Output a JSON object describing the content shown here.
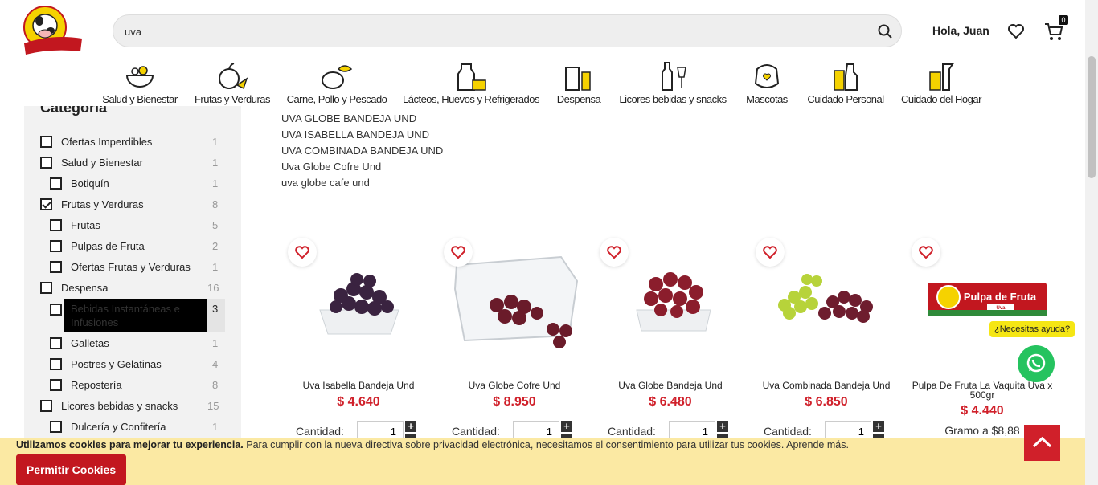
{
  "header": {
    "search_value": "uva",
    "search_icon": "search-icon",
    "greeting": "Hola, Juan",
    "cart_count": "0",
    "logo_alt": "La Vaquita"
  },
  "categories": [
    {
      "label": "Salud y Bienestar",
      "icon": "health-bowl-icon"
    },
    {
      "label": "Frutas y Verduras",
      "icon": "fruit-icon"
    },
    {
      "label": "Carne, Pollo y Pescado",
      "icon": "meat-icon"
    },
    {
      "label": "Lácteos, Huevos y Refrigerados",
      "icon": "dairy-icon"
    },
    {
      "label": "Despensa",
      "icon": "pantry-icon"
    },
    {
      "label": "Licores bebidas y snacks",
      "icon": "bottles-icon"
    },
    {
      "label": "Mascotas",
      "icon": "pet-icon"
    },
    {
      "label": "Cuidado Personal",
      "icon": "personal-care-icon"
    },
    {
      "label": "Cuidado del Hogar",
      "icon": "home-care-icon"
    }
  ],
  "sidebar": {
    "title": "Categoría",
    "facets": [
      {
        "label": "Ofertas Imperdibles",
        "count": "1",
        "checked": false
      },
      {
        "label": "Salud y Bienestar",
        "count": "1",
        "checked": false
      },
      {
        "label": "Botiquín",
        "count": "1",
        "checked": false
      },
      {
        "label": "Frutas y Verduras",
        "count": "8",
        "checked": true
      },
      {
        "label": "Frutas",
        "count": "5",
        "checked": false
      },
      {
        "label": "Pulpas de Fruta",
        "count": "2",
        "checked": false
      },
      {
        "label": "Ofertas Frutas y Verduras",
        "count": "1",
        "checked": false
      },
      {
        "label": "Despensa",
        "count": "16",
        "checked": false
      },
      {
        "label": "Bebidas Instantáneas e Infusiones",
        "count": "3",
        "checked": false
      },
      {
        "label": "Galletas",
        "count": "1",
        "checked": false
      },
      {
        "label": "Postres y Gelatinas",
        "count": "4",
        "checked": false
      },
      {
        "label": "Repostería",
        "count": "8",
        "checked": false
      },
      {
        "label": "Licores bebidas y snacks",
        "count": "15",
        "checked": false
      },
      {
        "label": "Dulcería y Confitería",
        "count": "1",
        "checked": false
      }
    ]
  },
  "suggestions": [
    "UVA GLOBE BANDEJA UND",
    "UVA ISABELLA BANDEJA UND",
    "UVA COMBINADA BANDEJA UND",
    "Uva Globe Cofre Und",
    "uva globe cafe und"
  ],
  "products": [
    {
      "name": "Uva Isabella Bandeja Und",
      "price": "$ 4.640",
      "qty_label": "Cantidad:",
      "qty": "1"
    },
    {
      "name": "Uva Globe Cofre Und",
      "price": "$ 8.950",
      "qty_label": "Cantidad:",
      "qty": "1"
    },
    {
      "name": "Uva Globe Bandeja Und",
      "price": "$ 6.480",
      "qty_label": "Cantidad:",
      "qty": "1"
    },
    {
      "name": "Uva Combinada Bandeja Und",
      "price": "$ 6.850",
      "qty_label": "Cantidad:",
      "qty": "1"
    },
    {
      "name": "Pulpa De Fruta La Vaquita Uva x 500gr",
      "price": "$ 4.440",
      "unit_price": "Gramo a $8,88",
      "pack_text": "Pulpa de Fruta",
      "pack_flavor": "Uva"
    }
  ],
  "whatsapp": {
    "help_text": "¿Necesitas ayuda?"
  },
  "cookie": {
    "bold": "Utilizamos cookies para mejorar tu experiencia.",
    "text": " Para cumplir con la nueva directiva sobre privacidad electrónica, necesitamos el consentimiento para utilizar tus cookies. ",
    "link": "Aprende más.",
    "button": "Permitir Cookies"
  },
  "colors": {
    "brand_red": "#d0202a",
    "cookie_bg": "#fbe9a3",
    "whatsapp": "#25c35f"
  }
}
